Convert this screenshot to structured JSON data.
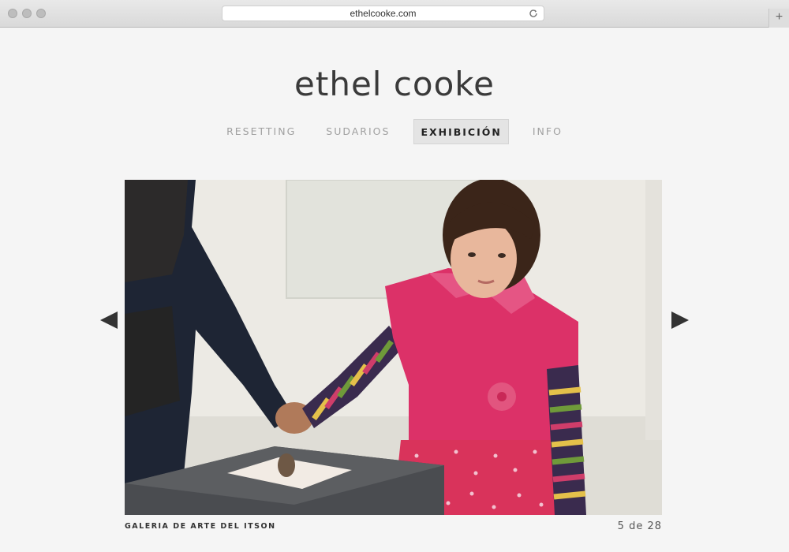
{
  "browser": {
    "url": "ethelcooke.com",
    "reload_icon": "reload-icon",
    "new_tab_label": "+"
  },
  "site": {
    "title": "ethel cooke"
  },
  "nav": {
    "items": [
      {
        "label": "RESETTING",
        "active": false
      },
      {
        "label": "SUDARIOS",
        "active": false
      },
      {
        "label": "EXHIBICIÓN",
        "active": true
      },
      {
        "label": "INFO",
        "active": false
      }
    ]
  },
  "gallery": {
    "caption": "GALERIA DE ARTE DEL ITSON",
    "counter": "5 de 28",
    "prev_icon": "arrow-left-icon",
    "next_icon": "arrow-right-icon"
  },
  "colors": {
    "accent": "#333333",
    "muted_nav": "#a0a0a0",
    "page_bg": "#f5f5f5"
  }
}
